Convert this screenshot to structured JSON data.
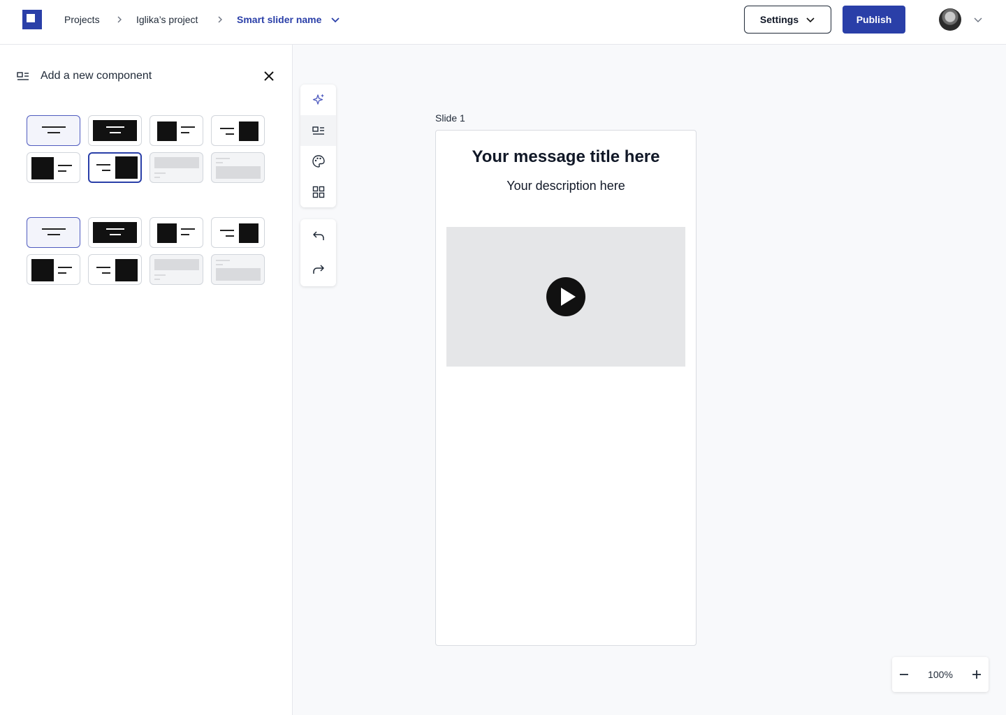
{
  "header": {
    "breadcrumbs": [
      "Projects",
      "Iglika’s project",
      "Smart slider name"
    ],
    "settings_label": "Settings",
    "publish_label": "Publish",
    "accent_color": "#2a3fa8"
  },
  "sidebar": {
    "title": "Add a new component",
    "icons": {
      "title_icon": "layout-icon",
      "close_icon": "close-icon"
    },
    "group_1": [
      "centered-text",
      "text-on-dark-image",
      "image-left-text",
      "text-image-right",
      "dark-image-left-text",
      "text-dark-image-right",
      "muted-banner",
      "muted-banner-text"
    ],
    "group_2": [
      "centered-text",
      "text-on-dark-image",
      "image-left-text",
      "text-image-right",
      "dark-image-left-text",
      "text-dark-image-right",
      "muted-banner",
      "muted-banner-text"
    ]
  },
  "toolbar": {
    "tools": [
      "sparkle-icon",
      "layout-icon",
      "palette-icon",
      "grid-icon"
    ],
    "history": [
      "undo-icon",
      "redo-icon"
    ],
    "active_tool": "layout-icon"
  },
  "canvas": {
    "slide_label": "Slide 1",
    "slide": {
      "title": "Your message title here",
      "description": "Your description here",
      "media": "video-placeholder"
    }
  },
  "zoom": {
    "value": "100%"
  }
}
